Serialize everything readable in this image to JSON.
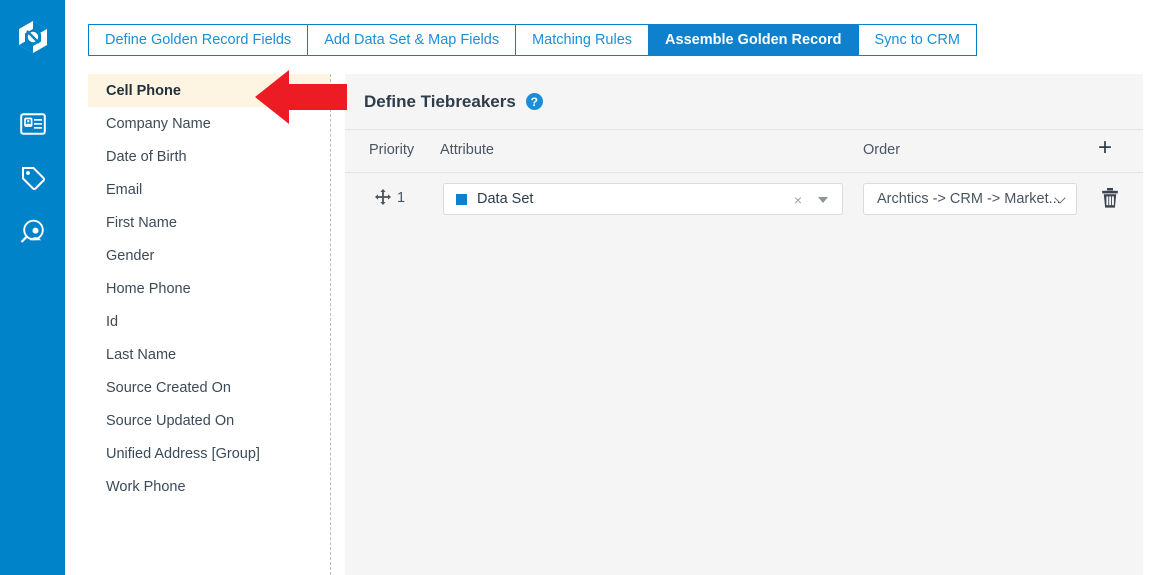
{
  "rail": {
    "logo_icon": "cube-logo-icon",
    "items": [
      {
        "icon": "id-card-icon",
        "name": "contacts"
      },
      {
        "icon": "tag-icon",
        "name": "tags"
      },
      {
        "icon": "person-search-icon",
        "name": "person-search"
      }
    ]
  },
  "tabs": [
    {
      "label": "Define Golden Record Fields",
      "active": false
    },
    {
      "label": "Add Data Set & Map Fields",
      "active": false
    },
    {
      "label": "Matching Rules",
      "active": false
    },
    {
      "label": "Assemble Golden Record",
      "active": true
    },
    {
      "label": "Sync to CRM",
      "active": false
    }
  ],
  "attribute_list": {
    "selected": "Cell Phone",
    "items": [
      "Cell Phone",
      "Company Name",
      "Date of Birth",
      "Email",
      "First Name",
      "Gender",
      "Home Phone",
      "Id",
      "Last Name",
      "Source Created On",
      "Source Updated On",
      "Unified Address [Group]",
      "Work Phone"
    ]
  },
  "panel": {
    "title": "Define Tiebreakers",
    "help_icon_glyph": "?",
    "columns": {
      "priority": "Priority",
      "attribute": "Attribute",
      "order": "Order"
    },
    "add_button_glyph": "+",
    "rows": [
      {
        "priority": "1",
        "attribute": "Data Set",
        "attribute_swatch_color": "#0f80cc",
        "clear_glyph": "×",
        "order": "Archtics -> CRM -> Market...",
        "delete_icon": "trash-icon",
        "drag_icon": "move-handle-icon"
      }
    ]
  },
  "annotation": {
    "arrow_color": "#ed1c24",
    "arrow_direction": "left",
    "points_at": "Cell Phone"
  },
  "colors": {
    "rail_blue": "#0083c8",
    "tab_active_blue": "#0f80cc",
    "tab_text_blue": "#1a8fd8",
    "selected_row_bg": "#fdf5e2",
    "panel_bg": "#f5f5f6"
  }
}
